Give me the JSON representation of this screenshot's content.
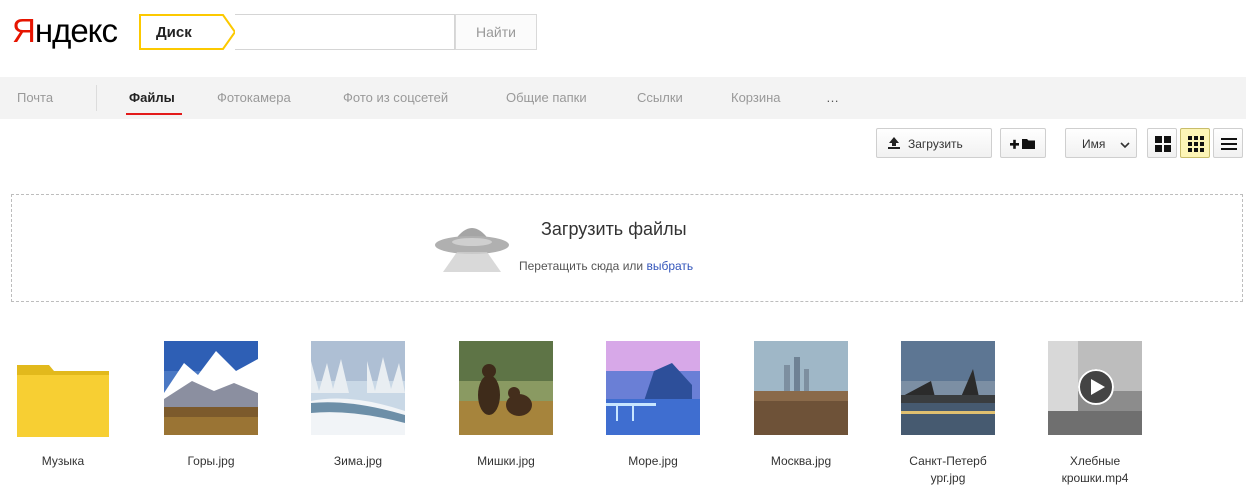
{
  "header": {
    "logo_first": "Я",
    "logo_rest": "ндекс",
    "service_tag": "Диск",
    "search_value": "",
    "search_button": "Найти"
  },
  "nav": {
    "items": [
      {
        "label": "Почта",
        "active": false
      },
      {
        "label": "Файлы",
        "active": true
      },
      {
        "label": "Фотокамера",
        "active": false
      },
      {
        "label": "Фото из соцсетей",
        "active": false
      },
      {
        "label": "Общие папки",
        "active": false
      },
      {
        "label": "Ссылки",
        "active": false
      },
      {
        "label": "Корзина",
        "active": false
      },
      {
        "label": "…",
        "active": false
      }
    ]
  },
  "toolbar": {
    "upload_label": "Загрузить",
    "new_folder_label": "+",
    "sort_label": "Имя",
    "sort_chevron": "⌄"
  },
  "dropzone": {
    "title": "Загрузить файлы",
    "subtitle": "Перетащить сюда или",
    "link": "выбрать"
  },
  "files": [
    {
      "name": "Музыка",
      "kind": "folder"
    },
    {
      "name": "Горы.jpg",
      "kind": "image"
    },
    {
      "name": "Зима.jpg",
      "kind": "image"
    },
    {
      "name": "Мишки.jpg",
      "kind": "image"
    },
    {
      "name": "Море.jpg",
      "kind": "image"
    },
    {
      "name": "Москва.jpg",
      "kind": "image"
    },
    {
      "name_line1": "Санкт-Петерб",
      "name_line2": "ург.jpg",
      "kind": "image"
    },
    {
      "name_line1": "Хлебные",
      "name_line2": "крошки.mp4",
      "kind": "video"
    }
  ],
  "colors": {
    "logo_red": "#e61400",
    "tag_yellow": "#fcc900",
    "active_underline": "#e31a1a",
    "link_blue": "#3355bb",
    "selected_view": "#fdf5b6"
  }
}
